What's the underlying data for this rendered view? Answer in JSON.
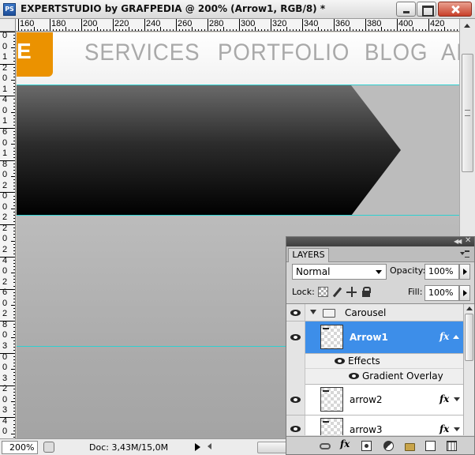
{
  "window": {
    "app_icon": "PS",
    "title": "EXPERTSTUDIO by GRAFPEDIA @ 200% (Arrow1, RGB/8) *"
  },
  "rulers": {
    "top_labels": [
      "160",
      "180",
      "200",
      "220",
      "240",
      "260",
      "280",
      "300",
      "320",
      "340",
      "360",
      "380",
      "400",
      "420"
    ],
    "left_labels": [
      "0",
      "0",
      "1",
      "2",
      "0",
      "1",
      "4",
      "0",
      "1",
      "6",
      "0",
      "1",
      "8",
      "0",
      "2",
      "0",
      "0",
      "2",
      "2",
      "0",
      "2",
      "4",
      "0",
      "2",
      "6",
      "0",
      "2",
      "8",
      "0",
      "3",
      "0",
      "0",
      "3",
      "2",
      "0",
      "3",
      "4",
      "0"
    ]
  },
  "canvas": {
    "logo_glyph": "E",
    "nav": [
      "SERVICES",
      "PORTFOLIO",
      "BLOG",
      "AB"
    ],
    "colors": {
      "logo": "#eb9200",
      "nav_text": "#a9a9a9",
      "guide": "#2fd0d0"
    }
  },
  "statusbar": {
    "zoom": "200%",
    "doc_size": "Doc: 3,43M/15,0M"
  },
  "layers_panel": {
    "tab_label": "LAYERS",
    "blend_mode": "Normal",
    "opacity_label": "Opacity:",
    "opacity_value": "100%",
    "lock_label": "Lock:",
    "fill_label": "Fill:",
    "fill_value": "100%",
    "group_name": "Carousel",
    "selected_layer": "Arrow1",
    "effects_label": "Effects",
    "effect_name": "Gradient Overlay",
    "layers": [
      "arrow2",
      "arrow3"
    ],
    "fx_symbol": "fx"
  }
}
